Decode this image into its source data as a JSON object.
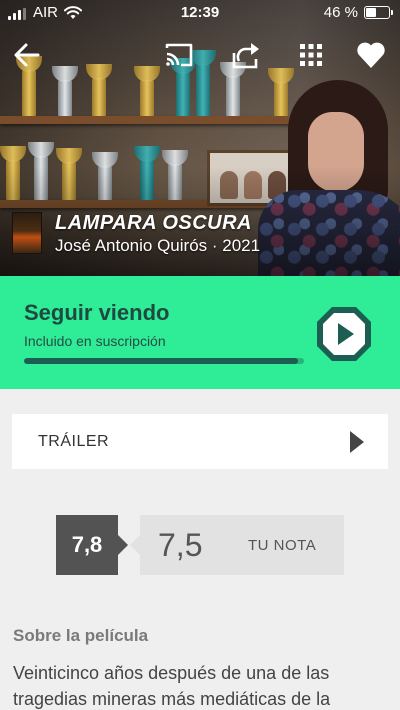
{
  "status_bar": {
    "carrier": "AIR",
    "time": "12:39",
    "battery": "46 %",
    "battery_level": 0.46
  },
  "toolbar": {
    "back_icon": "arrow-left-icon",
    "cast_icon": "cast-icon",
    "share_icon": "share-icon",
    "grid_icon": "grid-icon",
    "favorite_icon": "heart-icon"
  },
  "movie": {
    "title": "LAMPARA OSCURA",
    "subtitle": "José Antonio Quirós · 2021"
  },
  "continue_watching": {
    "title": "Seguir viendo",
    "subtitle": "Incluido en suscripción",
    "progress": 0.98,
    "play_icon": "play-icon",
    "accent": "#2fec96"
  },
  "trailer": {
    "label": "TRÁILER",
    "icon": "play-triangle-icon"
  },
  "ratings": {
    "average": "7,8",
    "my_rating": "7,5",
    "my_rating_label": "TU NOTA"
  },
  "about": {
    "title": "Sobre la película",
    "text": "Veinticinco años después de una de las tragedias mineras más mediáticas de la"
  }
}
